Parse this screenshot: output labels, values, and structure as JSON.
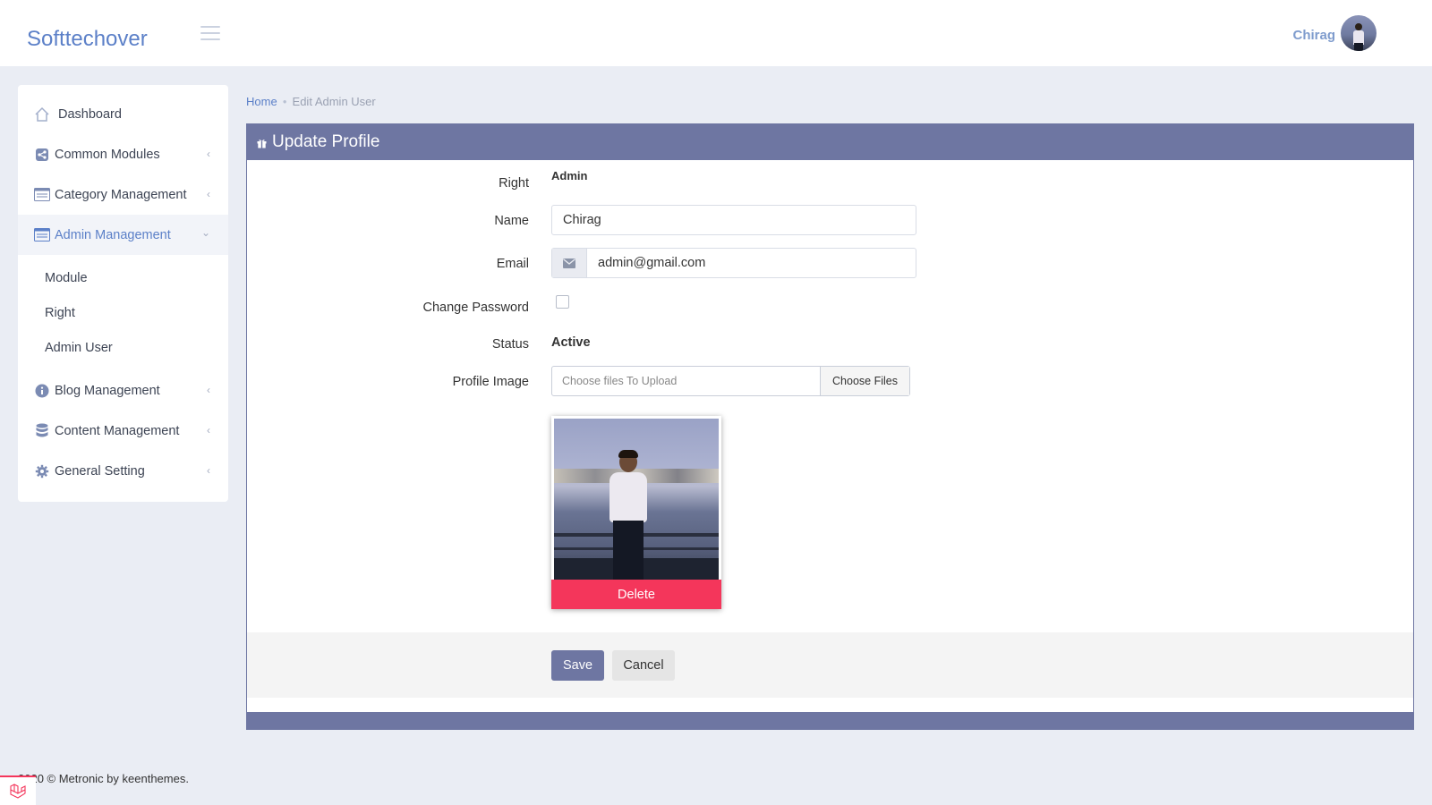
{
  "header": {
    "brand": "Softtechover",
    "user_name": "Chirag"
  },
  "sidebar": {
    "items": [
      {
        "label": "Dashboard",
        "icon": "home-icon"
      },
      {
        "label": "Common Modules",
        "icon": "share-icon"
      },
      {
        "label": "Category Management",
        "icon": "list-icon"
      },
      {
        "label": "Admin Management",
        "icon": "list-icon",
        "active": true
      },
      {
        "label": "Blog Management",
        "icon": "info-icon"
      },
      {
        "label": "Content Management",
        "icon": "database-icon"
      },
      {
        "label": "General Setting",
        "icon": "gear-icon"
      }
    ],
    "sub_items": [
      {
        "label": "Module"
      },
      {
        "label": "Right"
      },
      {
        "label": "Admin User"
      }
    ]
  },
  "breadcrumb": {
    "home": "Home",
    "current": "Edit Admin User"
  },
  "form": {
    "title": "Update Profile",
    "right_label": "Right",
    "right_value": "Admin",
    "name_label": "Name",
    "name_value": "Chirag",
    "email_label": "Email",
    "email_value": "admin@gmail.com",
    "password_label": "Change Password",
    "status_label": "Status",
    "status_value": "Active",
    "image_label": "Profile Image",
    "file_placeholder": "Choose files To Upload",
    "choose_files": "Choose Files",
    "delete": "Delete",
    "save": "Save",
    "cancel": "Cancel"
  },
  "footer": {
    "text": "2020 © Metronic by keenthemes."
  },
  "colors": {
    "accent": "#6e76a2",
    "brand": "#5c80c8",
    "danger": "#f4365b",
    "background": "#eaedf4"
  }
}
